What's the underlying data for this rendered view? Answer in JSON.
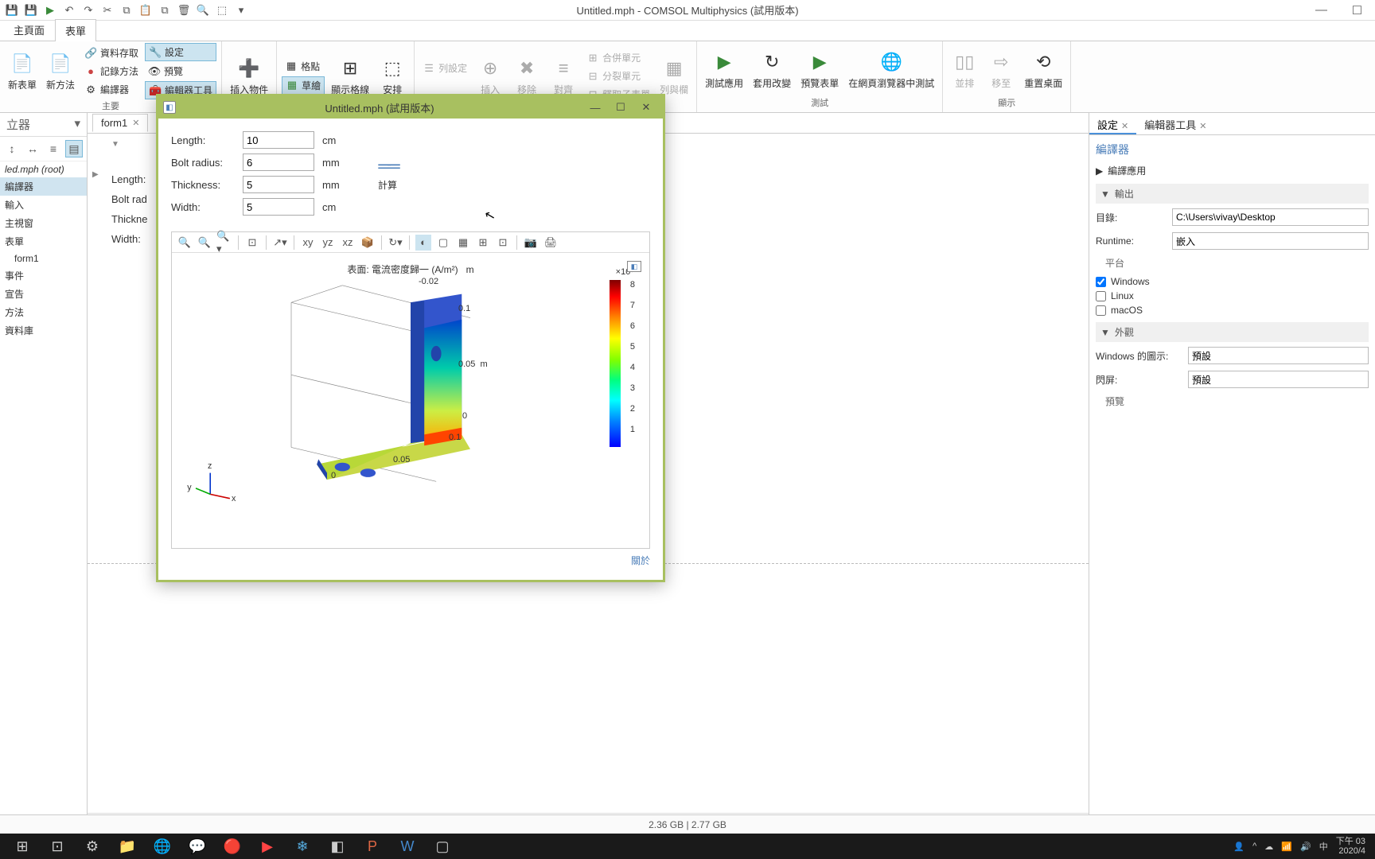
{
  "app": {
    "title": "Untitled.mph - COMSOL Multiphysics (試用版本)"
  },
  "ribbon": {
    "tabs": {
      "main": "主頁面",
      "form": "表單"
    },
    "groups": {
      "new_form": "新表單",
      "new_method": "新方法",
      "data_access": "資料存取",
      "record_method": "記錄方法",
      "compiler": "編譯器",
      "settings": "設定",
      "preview": "預覽",
      "editor_tools": "編輯器工具",
      "insert_object": "插入物件",
      "grid": "格點",
      "sketch": "草繪",
      "show_grid": "顯示格線",
      "arrange": "安排",
      "col_settings": "列設定",
      "insert": "插入",
      "move": "移除",
      "align": "對齊",
      "merge_cells": "合併單元",
      "split_cells": "分裂單元",
      "extract_subform": "釋取子表單",
      "row_col": "列與欄",
      "test_app": "測試應用",
      "apply_changes": "套用改變",
      "preview_form": "預覽表單",
      "test_in_browser": "在網頁瀏覽器中測試",
      "tile": "並排",
      "move_to": "移至",
      "reset_desktop": "重置桌面",
      "main_label": "主要",
      "test_label": "測試",
      "display_label": "顯示"
    }
  },
  "left": {
    "title": "立器",
    "tree": {
      "root": "led.mph (root)",
      "compiler": "編譯器",
      "input": "輸入",
      "main_window": "主視窗",
      "forms": "表單",
      "form1": "form1",
      "events": "事件",
      "declarations": "宣告",
      "methods": "方法",
      "libraries": "資料庫"
    }
  },
  "doc": {
    "tab": "form1"
  },
  "design_labels": {
    "length": "Length:",
    "bolt_radius": "Bolt rad",
    "thickness": "Thickne",
    "width": "Width:"
  },
  "modal": {
    "title": "Untitled.mph (試用版本)",
    "fields": {
      "length": {
        "label": "Length:",
        "value": "10",
        "unit": "cm"
      },
      "bolt_radius": {
        "label": "Bolt radius:",
        "value": "6",
        "unit": "mm"
      },
      "thickness": {
        "label": "Thickness:",
        "value": "5",
        "unit": "mm"
      },
      "width": {
        "label": "Width:",
        "value": "5",
        "unit": "cm"
      }
    },
    "compute": "計算",
    "about": "關於",
    "plot": {
      "title": "表面: 電流密度歸一 (A/m²)",
      "m_unit": "m",
      "exp": "×10³",
      "ticks": {
        "z1": "0.1",
        "z2": "0.05",
        "z3": "0",
        "x1": "0",
        "x2": "0.05",
        "y_neg": "-0.02"
      },
      "axis": {
        "x": "x",
        "y": "y",
        "z": "z"
      },
      "colorbar": [
        "8",
        "7",
        "6",
        "5",
        "4",
        "3",
        "2",
        "1"
      ]
    }
  },
  "right": {
    "tabs": {
      "settings": "設定",
      "editor_tools": "編輯器工具"
    },
    "section_title": "編譯器",
    "compile_app": "編譯應用",
    "output": "輸出",
    "dir_label": "目錄:",
    "dir_value": "C:\\Users\\vivay\\Desktop",
    "runtime_label": "Runtime:",
    "runtime_value": "嵌入",
    "platform": "平台",
    "windows": "Windows",
    "linux": "Linux",
    "macos": "macOS",
    "appearance": "外觀",
    "icon_label": "Windows 的圖示:",
    "icon_value": "預設",
    "splash_label": "閃屏:",
    "splash_value": "預設",
    "preview": "預覽"
  },
  "status": {
    "memory": "2.36 GB | 2.77 GB"
  },
  "taskbar": {
    "time": "下午 03",
    "date": "2020/4",
    "ime": "中"
  },
  "chart_data": {
    "type": "3d-surface-colormap",
    "title": "表面: 電流密度歸一 (A/m²)",
    "colorbar_range": [
      1,
      8
    ],
    "colorbar_exponent": 3,
    "colorbar_ticks": [
      1,
      2,
      3,
      4,
      5,
      6,
      7,
      8
    ],
    "axes": {
      "x": {
        "label": "m",
        "range": [
          0,
          0.05
        ]
      },
      "y": {
        "label": "m",
        "range": [
          -0.02,
          0
        ]
      },
      "z": {
        "label": "m",
        "range": [
          0,
          0.1
        ]
      }
    },
    "geometry": "L-bracket with bolt holes",
    "parameters": {
      "length_cm": 10,
      "bolt_radius_mm": 6,
      "thickness_mm": 5,
      "width_cm": 5
    }
  }
}
